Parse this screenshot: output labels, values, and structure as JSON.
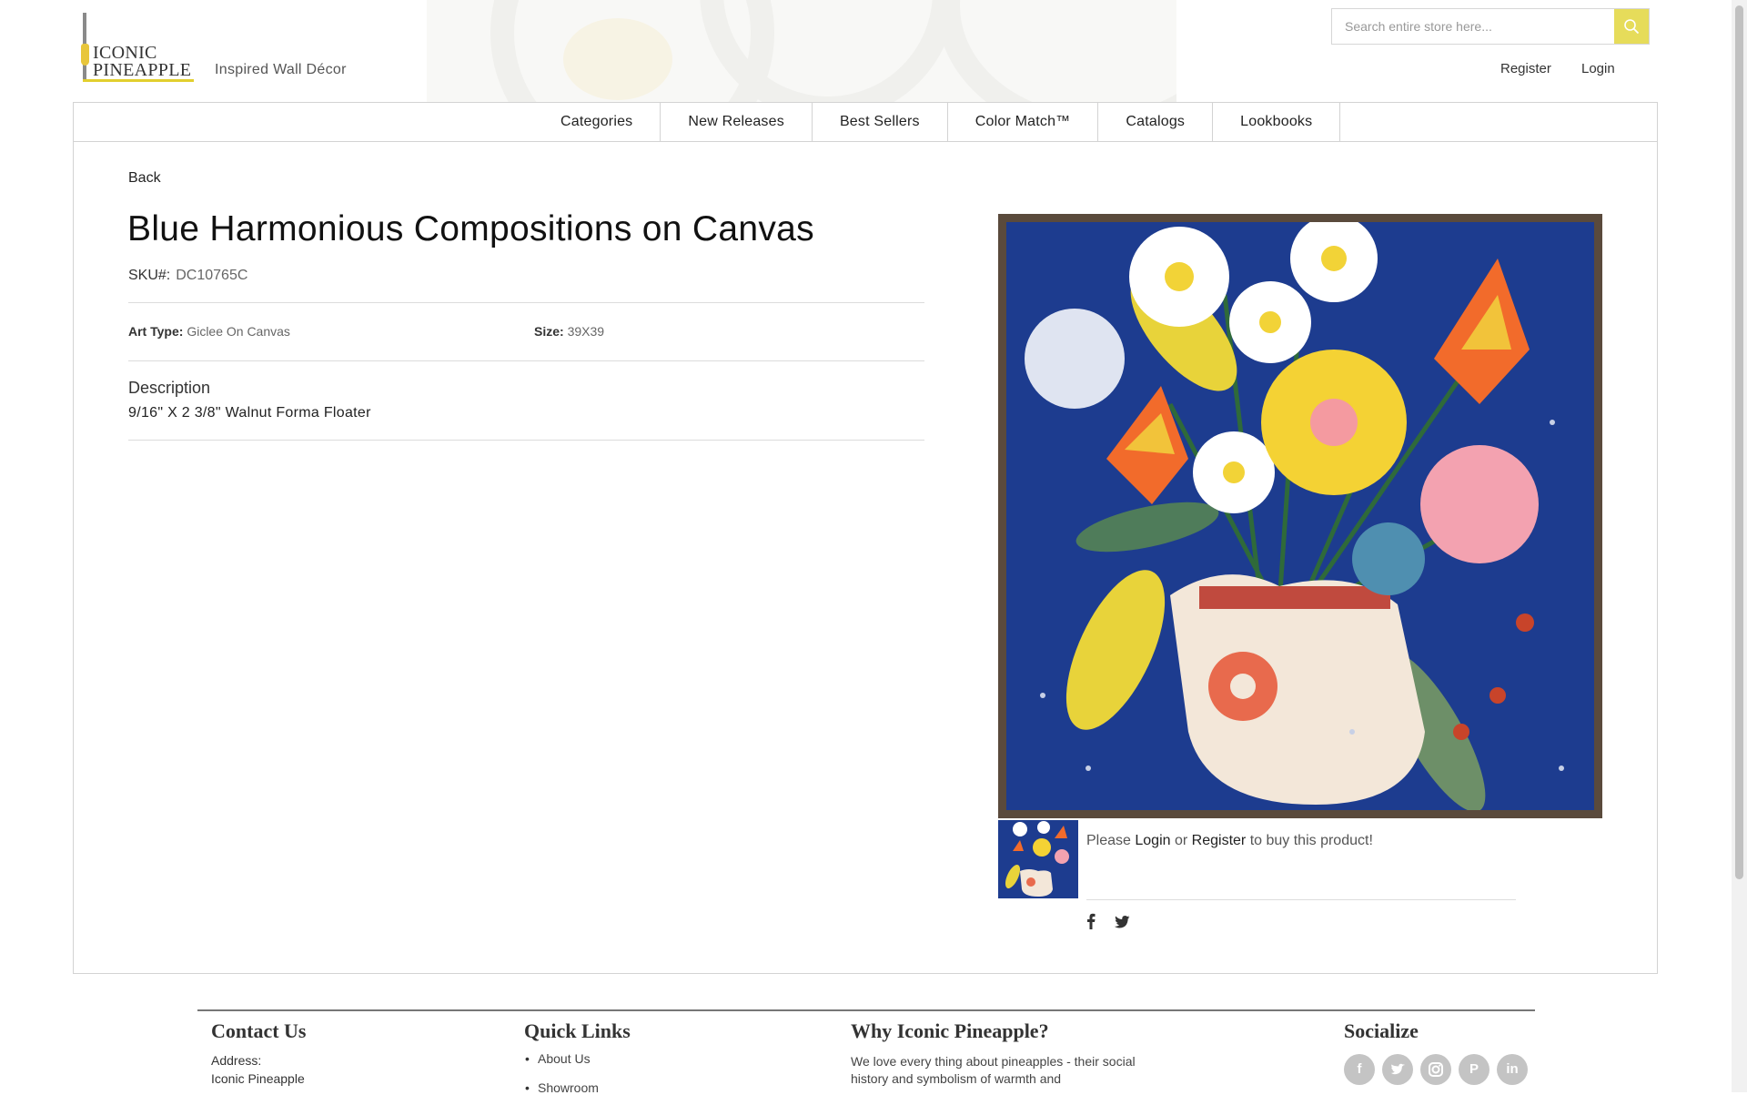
{
  "header": {
    "logo_line1": "ICONIC",
    "logo_line2": "PINEAPPLE",
    "tagline": "Inspired Wall Décor",
    "search_placeholder": "Search entire store here...",
    "register": "Register",
    "login": "Login"
  },
  "nav": {
    "items": [
      "Categories",
      "New Releases",
      "Best Sellers",
      "Color Match™",
      "Catalogs",
      "Lookbooks"
    ]
  },
  "product": {
    "back": "Back",
    "title": "Blue Harmonious Compositions on Canvas",
    "sku_label": "SKU#:",
    "sku_value": "DC10765C",
    "art_type_label": "Art Type:",
    "art_type_value": "Giclee On Canvas",
    "size_label": "Size:",
    "size_value": "39X39",
    "description_heading": "Description",
    "description_text": "9/16\" X 2 3/8\" Walnut Forma Floater",
    "buy_prefix": "Please",
    "buy_login": "Login",
    "buy_or": "or",
    "buy_register": "Register",
    "buy_suffix": "to buy this product!"
  },
  "footer": {
    "contact_heading": "Contact Us",
    "address_label": "Address:",
    "address_line1": "Iconic Pineapple",
    "quick_heading": "Quick Links",
    "quick_links": [
      "About Us",
      "Showroom"
    ],
    "why_heading": "Why Iconic Pineapple?",
    "why_text": "We love every thing about pineapples - their social history and symbolism of warmth and",
    "social_heading": "Socialize"
  },
  "icons": {
    "search": "search-icon",
    "facebook": "facebook-icon",
    "twitter": "twitter-icon",
    "instagram": "instagram-icon",
    "pinterest": "pinterest-icon",
    "linkedin": "linkedin-icon"
  },
  "colors": {
    "accent": "#e6dc5a",
    "logo_yellow": "#e2cf2e",
    "canvas_blue": "#1c3a8a",
    "frame_walnut": "#5a4a3c"
  }
}
